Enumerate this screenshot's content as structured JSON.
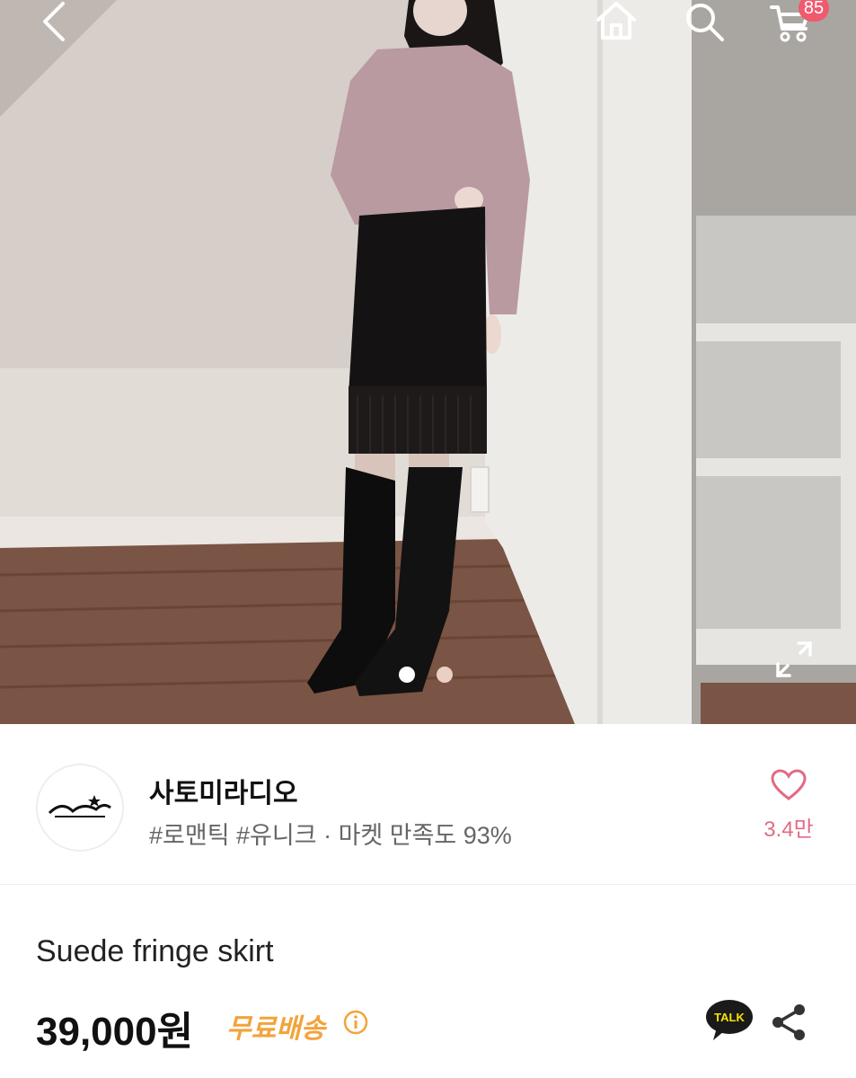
{
  "header": {
    "back_icon": "chevron-left-icon",
    "home_icon": "home-icon",
    "search_icon": "search-icon",
    "cart_icon": "cart-icon",
    "cart_count": "85"
  },
  "gallery": {
    "current_index": 1,
    "total": 2,
    "expand_icon": "expand-icon"
  },
  "shop": {
    "logo_text": "사토미라디오",
    "name": "사토미라디오",
    "meta": "#로맨틱 #유니크 · 마켓 만족도 93%",
    "like_count": "3.4만"
  },
  "product": {
    "title": "Suede fringe skirt",
    "price": "39,000원",
    "shipping": "무료배송",
    "talk_label": "TALK"
  },
  "colors": {
    "accent_pink": "#e36a84",
    "badge": "#f05a6e",
    "shipping": "#f3a33b",
    "kakao_yellow": "#fae100"
  }
}
